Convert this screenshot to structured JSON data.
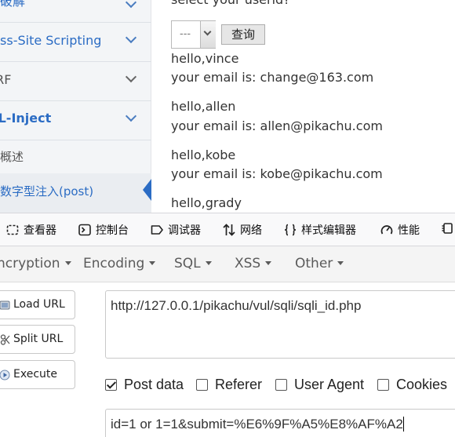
{
  "sidebar": {
    "items": [
      {
        "label": "力破解"
      },
      {
        "label": "ross-Site Scripting"
      },
      {
        "label": "SRF"
      },
      {
        "label": "QL-Inject"
      }
    ],
    "sub_items": [
      {
        "label": "概述"
      },
      {
        "label": "数字型注入(post)"
      }
    ]
  },
  "main": {
    "question": "select your userid?",
    "select_value": "---",
    "query_button": "查询",
    "results": [
      {
        "hello": "hello,vince",
        "email": "your email is: change@163.com"
      },
      {
        "hello": "hello,allen",
        "email": "your email is: allen@pikachu.com"
      },
      {
        "hello": "hello,kobe",
        "email": "your email is: kobe@pikachu.com"
      },
      {
        "hello": "hello,grady",
        "email": ""
      }
    ]
  },
  "devtools": {
    "tabs": [
      {
        "label": "查看器",
        "icon": "inspector-icon"
      },
      {
        "label": "控制台",
        "icon": "console-icon"
      },
      {
        "label": "调试器",
        "icon": "debugger-icon"
      },
      {
        "label": "网络",
        "icon": "network-icon"
      },
      {
        "label": "样式编辑器",
        "icon": "style-editor-icon"
      },
      {
        "label": "性能",
        "icon": "performance-icon"
      }
    ]
  },
  "hackbar": {
    "menu": [
      "ncryption",
      "Encoding",
      "SQL",
      "XSS",
      "Other"
    ],
    "buttons": {
      "load_url": "Load URL",
      "split_url": "Split URL",
      "execute": "Execute"
    },
    "url_value": "http://127.0.0.1/pikachu/vul/sqli/sqli_id.php",
    "checkboxes": [
      {
        "label": "Post data",
        "checked": true
      },
      {
        "label": "Referer",
        "checked": false
      },
      {
        "label": "User Agent",
        "checked": false
      },
      {
        "label": "Cookies",
        "checked": false
      }
    ],
    "post_value": "id=1 or 1=1&submit=%E6%9F%A5%E8%AF%A2"
  },
  "colors": {
    "accent": "#2b6cc4",
    "sidebar_bg": "#f3f5f7",
    "link_blue": "#2b6cc4"
  }
}
